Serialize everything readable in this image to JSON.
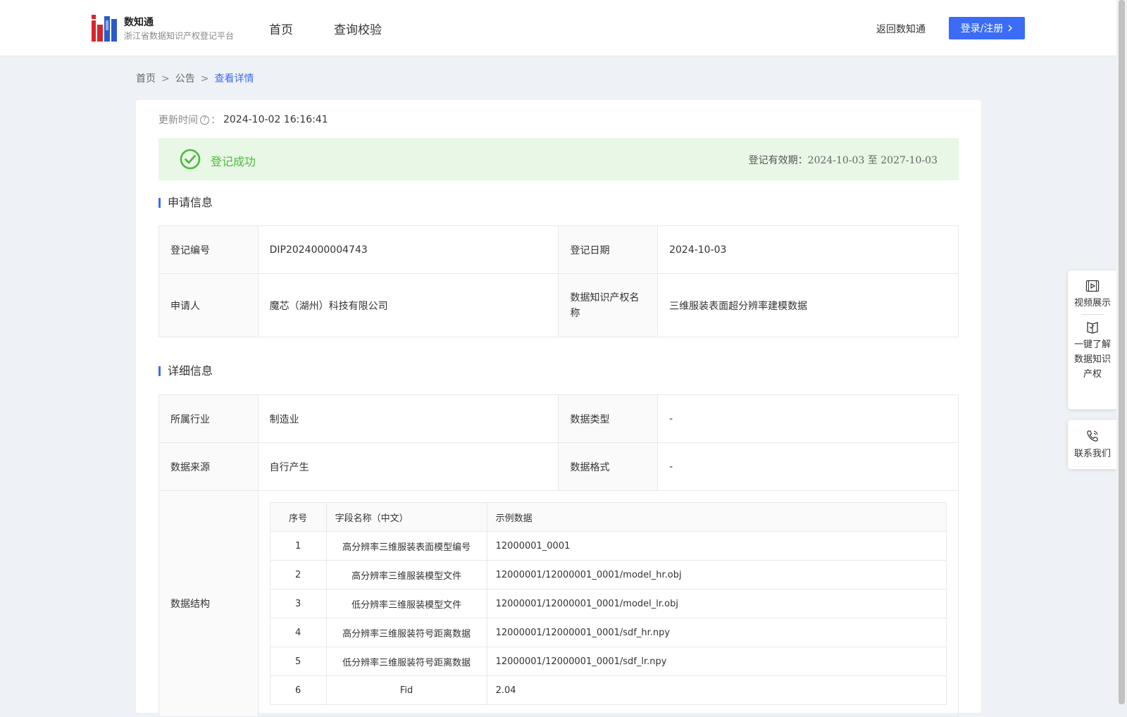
{
  "header": {
    "brand_title": "数知通",
    "brand_subtitle": "浙江省数据知识产权登记平台",
    "nav": [
      "首页",
      "查询校验"
    ],
    "back_link": "返回数知通",
    "login_button": "登录/注册"
  },
  "breadcrumb": [
    "首页",
    "公告",
    "查看详情"
  ],
  "update": {
    "label": "更新时间",
    "colon": "：",
    "value": "2024-10-02 16:16:41"
  },
  "status": {
    "text": "登记成功",
    "validity_label": "登记有效期：",
    "validity_dates": "2024-10-03 至 2027-10-03"
  },
  "application": {
    "title": "申请信息",
    "reg_no_label": "登记编号",
    "reg_no": "DIP2024000004743",
    "reg_date_label": "登记日期",
    "reg_date": "2024-10-03",
    "applicant_label": "申请人",
    "applicant": "魔芯（湖州）科技有限公司",
    "ip_name_label": "数据知识产权名称",
    "ip_name": "三维服装表面超分辨率建模数据"
  },
  "details": {
    "title": "详细信息",
    "industry_label": "所属行业",
    "industry": "制造业",
    "data_type_label": "数据类型",
    "data_type": "-",
    "source_label": "数据来源",
    "source": "自行产生",
    "format_label": "数据格式",
    "format": "-",
    "structure_label": "数据结构",
    "structure_headers": [
      "序号",
      "字段名称（中文）",
      "示例数据"
    ],
    "structure_rows": [
      [
        "1",
        "高分辨率三维服装表面模型编号",
        "12000001_0001"
      ],
      [
        "2",
        "高分辨率三维服装模型文件",
        "12000001/12000001_0001/model_hr.obj"
      ],
      [
        "3",
        "低分辨率三维服装模型文件",
        "12000001/12000001_0001/model_lr.obj"
      ],
      [
        "4",
        "高分辨率三维服装符号距离数据",
        "12000001/12000001_0001/sdf_hr.npy"
      ],
      [
        "5",
        "低分辨率三维服装符号距离数据",
        "12000001/12000001_0001/sdf_lr.npy"
      ],
      [
        "6",
        "Fid",
        "2.04"
      ]
    ]
  },
  "float_panel": {
    "video": "视频展示",
    "learn": "一键了解数据知识产权",
    "contact": "联系我们"
  },
  "colors": {
    "accent": "#3b6cf5",
    "success": "#4cbb3b",
    "success_bg": "#e8f7e6"
  }
}
